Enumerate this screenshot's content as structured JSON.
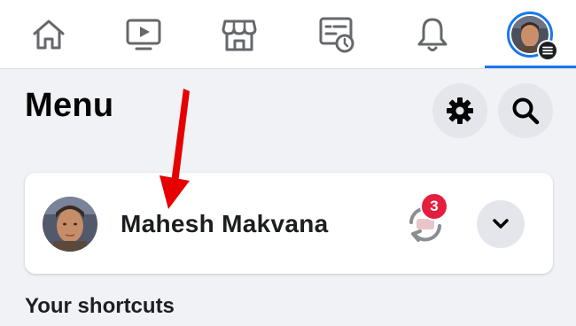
{
  "nav": {
    "tabs": [
      {
        "name": "home",
        "icon": "home-icon"
      },
      {
        "name": "watch",
        "icon": "video-play-icon"
      },
      {
        "name": "marketplace",
        "icon": "storefront-icon"
      },
      {
        "name": "memories",
        "icon": "newsfeed-clock-icon"
      },
      {
        "name": "notifications",
        "icon": "bell-icon"
      },
      {
        "name": "menu",
        "icon": "profile-menu-icon",
        "active": true
      }
    ]
  },
  "menu": {
    "title": "Menu",
    "settings_icon": "gear-icon",
    "search_icon": "search-icon"
  },
  "profile": {
    "name": "Mahesh Makvana",
    "account_switch_icon": "account-switch-icon",
    "badge_count": "3",
    "expand_icon": "chevron-down-icon"
  },
  "shortcuts": {
    "label": "Your shortcuts"
  },
  "annotation": {
    "arrow_color": "#e60000"
  },
  "colors": {
    "accent": "#1877f2",
    "badge": "#e41e3f",
    "background": "#f0f2f5"
  }
}
